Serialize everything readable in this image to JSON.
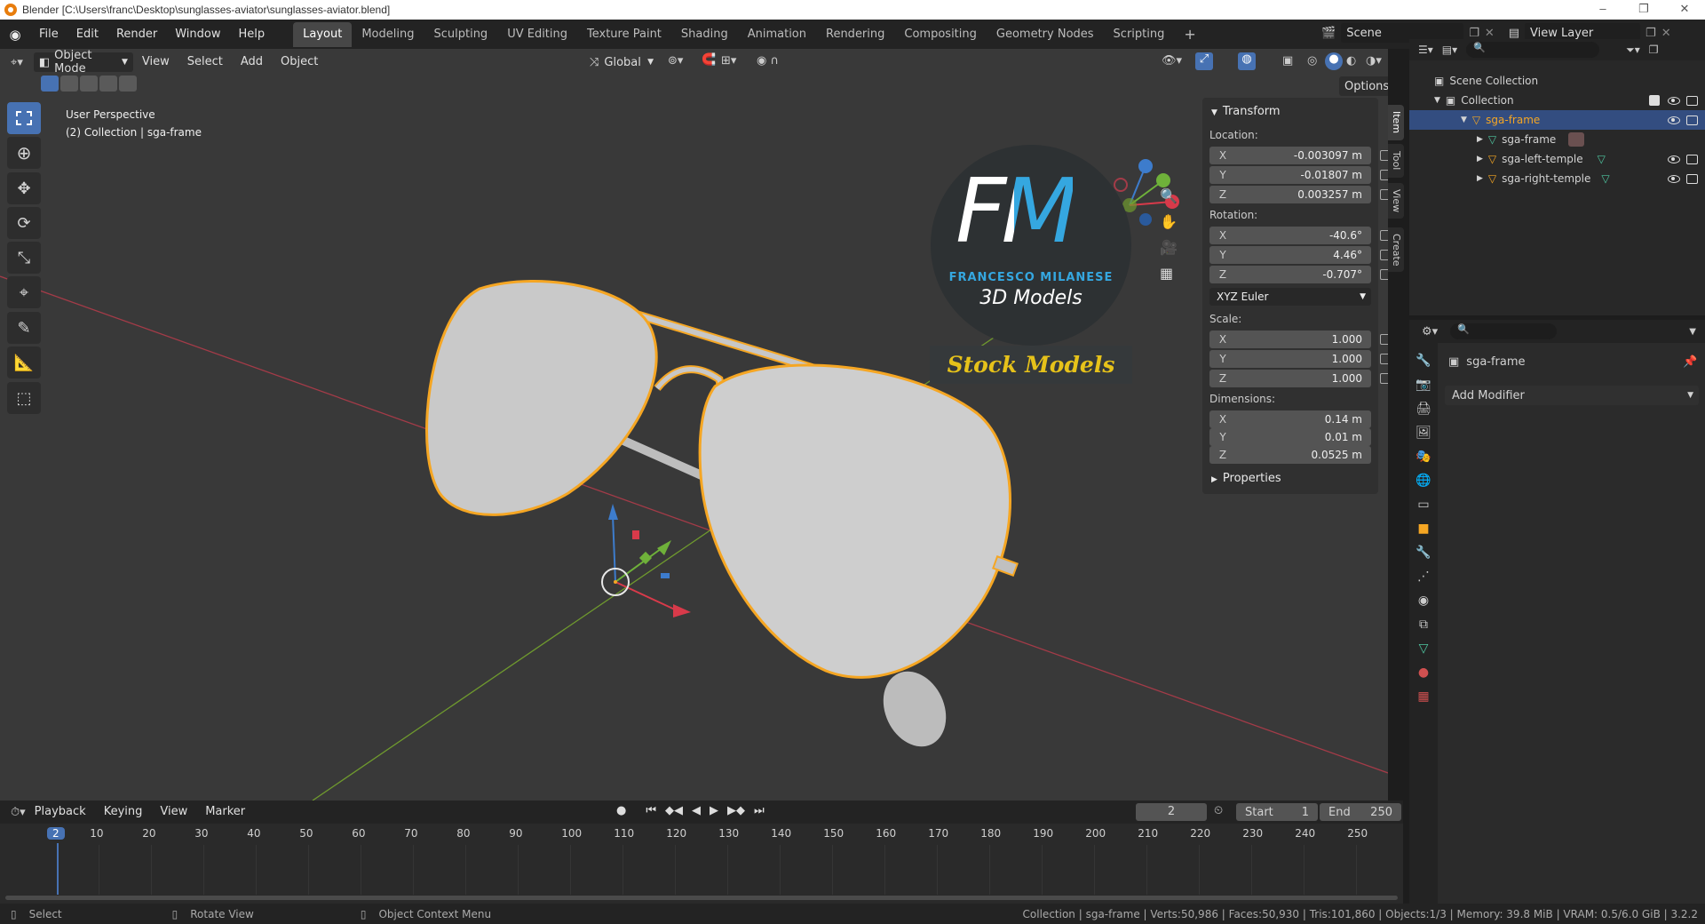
{
  "window": {
    "title": "Blender [C:\\Users\\franc\\Desktop\\sunglasses-aviator\\sunglasses-aviator.blend]"
  },
  "menu": [
    "File",
    "Edit",
    "Render",
    "Window",
    "Help"
  ],
  "workspaces": [
    "Layout",
    "Modeling",
    "Sculpting",
    "UV Editing",
    "Texture Paint",
    "Shading",
    "Animation",
    "Rendering",
    "Compositing",
    "Geometry Nodes",
    "Scripting"
  ],
  "scene": {
    "name": "Scene",
    "view_layer": "View Layer"
  },
  "viewport": {
    "mode": "Object Mode",
    "menus": [
      "View",
      "Select",
      "Add",
      "Object"
    ],
    "transform_orientation": "Global",
    "options_label": "Options",
    "overlay_line1": "User Perspective",
    "overlay_line2": "(2) Collection | sga-frame"
  },
  "logo": {
    "letters": "FM",
    "name": "FRANCESCO MILANESE",
    "sub": "3D Models",
    "banner": "Stock Models"
  },
  "npanel": {
    "section": "Transform",
    "location_label": "Location:",
    "location": [
      {
        "axis": "X",
        "value": "-0.003097 m"
      },
      {
        "axis": "Y",
        "value": "-0.01807 m"
      },
      {
        "axis": "Z",
        "value": "0.003257 m"
      }
    ],
    "rotation_label": "Rotation:",
    "rotation": [
      {
        "axis": "X",
        "value": "-40.6°"
      },
      {
        "axis": "Y",
        "value": "4.46°"
      },
      {
        "axis": "Z",
        "value": "-0.707°"
      }
    ],
    "rotation_mode": "XYZ Euler",
    "scale_label": "Scale:",
    "scale": [
      {
        "axis": "X",
        "value": "1.000"
      },
      {
        "axis": "Y",
        "value": "1.000"
      },
      {
        "axis": "Z",
        "value": "1.000"
      }
    ],
    "dimensions_label": "Dimensions:",
    "dimensions": [
      {
        "axis": "X",
        "value": "0.14 m"
      },
      {
        "axis": "Y",
        "value": "0.01 m"
      },
      {
        "axis": "Z",
        "value": "0.0525 m"
      }
    ],
    "properties_label": "Properties",
    "tabs": [
      "Item",
      "Tool",
      "View",
      "Create"
    ]
  },
  "outliner": {
    "rows": [
      {
        "label": "Scene Collection"
      },
      {
        "label": "Collection"
      },
      {
        "label": "sga-frame"
      },
      {
        "label": "sga-frame"
      },
      {
        "label": "sga-left-temple"
      },
      {
        "label": "sga-right-temple"
      }
    ]
  },
  "properties": {
    "object_name": "sga-frame",
    "add_modifier": "Add Modifier"
  },
  "timeline": {
    "menus": [
      "Playback",
      "Keying",
      "View",
      "Marker"
    ],
    "current_frame": "2",
    "start_label": "Start",
    "start": "1",
    "end_label": "End",
    "end": "250",
    "ticks": [
      "2",
      "10",
      "20",
      "30",
      "40",
      "50",
      "60",
      "70",
      "80",
      "90",
      "100",
      "110",
      "120",
      "130",
      "140",
      "150",
      "160",
      "170",
      "180",
      "190",
      "200",
      "210",
      "220",
      "230",
      "240",
      "250"
    ]
  },
  "status": {
    "left": [
      "Select",
      "Rotate View",
      "Object Context Menu"
    ],
    "right": "Collection | sga-frame | Verts:50,986 | Faces:50,930 | Tris:101,860 | Objects:1/3 | Memory: 39.8 MiB | VRAM: 0.5/6.0 GiB | 3.2.2"
  },
  "colors": {
    "accent": "#4772b3",
    "selection": "#f5a623",
    "x_axis": "#a33b48",
    "y_axis": "#6f9a2e",
    "logo_blue": "#35a7e0",
    "banner_text": "#e6c21a"
  }
}
